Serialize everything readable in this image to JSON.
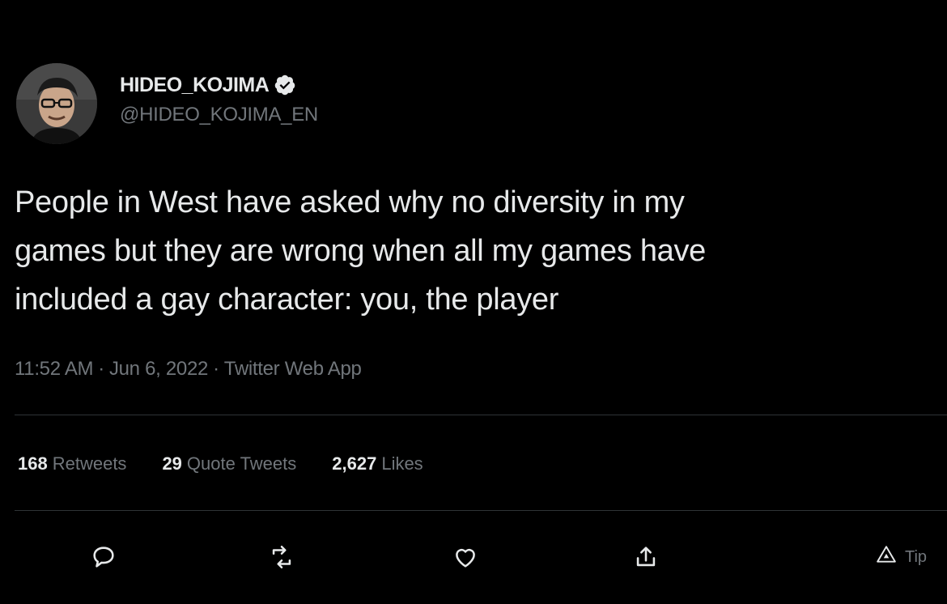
{
  "author": {
    "display_name": "HIDEO_KOJIMA",
    "handle": "@HIDEO_KOJIMA_EN",
    "verified": true
  },
  "tweet": {
    "text_lines": [
      "People in West have asked why no diversity in my",
      "games but they are wrong when all my games have",
      "included a gay character: you, the player"
    ],
    "time": "11:52 AM",
    "date": "Jun 6, 2022",
    "source": "Twitter Web App"
  },
  "stats": {
    "retweets": {
      "count": "168",
      "label": "Retweets"
    },
    "quote_tweets": {
      "count": "29",
      "label": "Quote Tweets"
    },
    "likes": {
      "count": "2,627",
      "label": "Likes"
    }
  },
  "actions": {
    "reply_icon": "reply-icon",
    "retweet_icon": "retweet-icon",
    "like_icon": "heart-icon",
    "share_icon": "share-icon",
    "tip_icon": "tip-icon",
    "tip_label": "Tip"
  },
  "colors": {
    "background": "#000000",
    "text": "#e7e9ea",
    "muted": "#71767b",
    "divider": "#2f3336"
  }
}
